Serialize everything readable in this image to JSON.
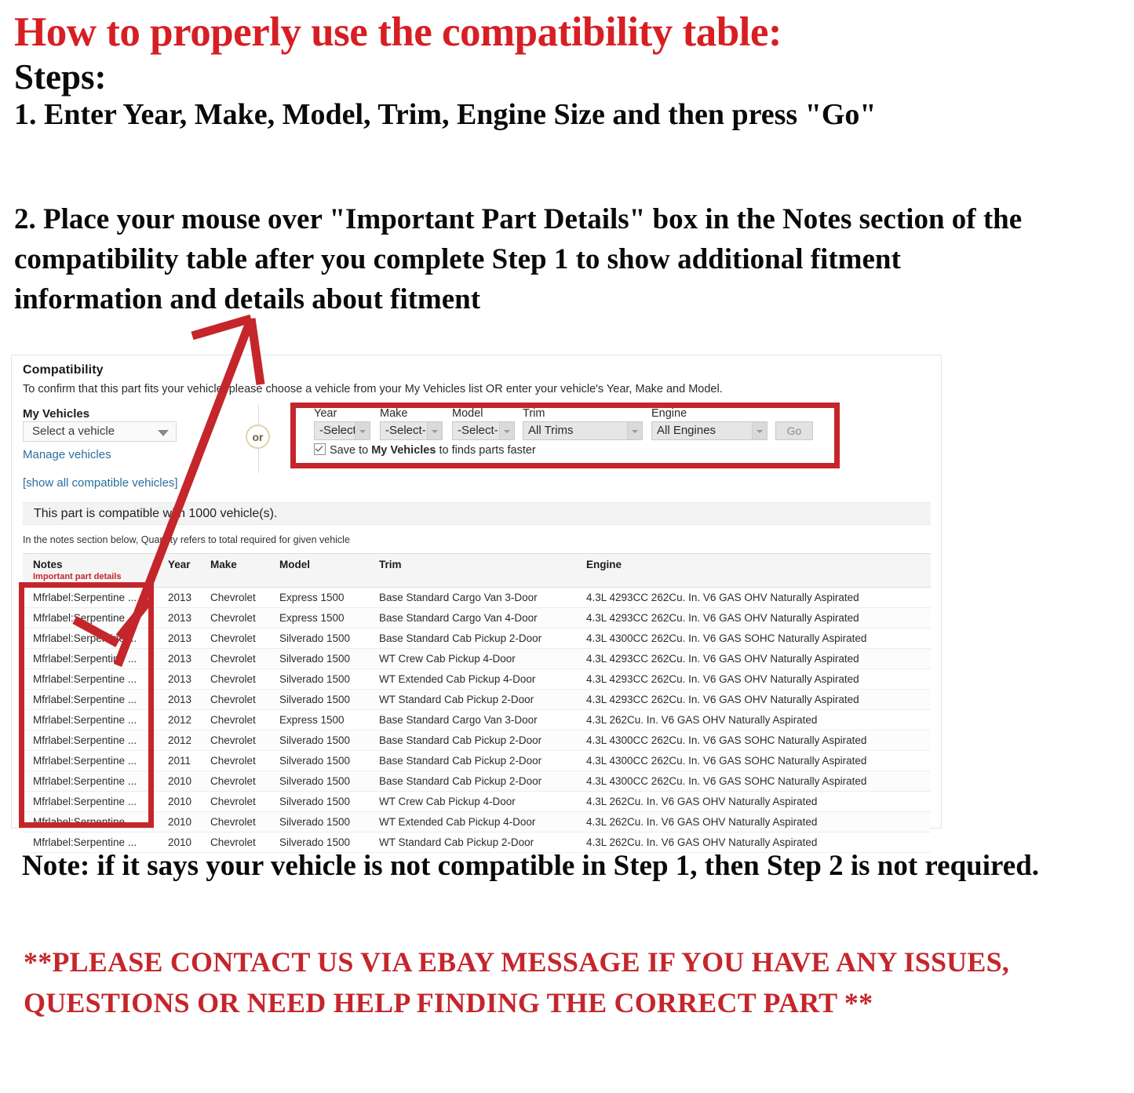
{
  "instructions": {
    "title": "How to properly use the compatibility table:",
    "steps_label": "Steps:",
    "step_one": "1. Enter Year, Make, Model, Trim, Engine Size and then press \"Go\"",
    "step_two": "2. Place your mouse over \"Important Part Details\" box in the Notes section of the compatibility table after you complete Step 1 to show additional fitment information and details about fitment",
    "note_bottom": "Note: if it says your vehicle is not compatible in Step 1, then Step 2 is not required.",
    "contact_notice": "**PLEASE CONTACT US VIA EBAY MESSAGE IF YOU HAVE ANY ISSUES, QUESTIONS OR NEED HELP FINDING THE CORRECT PART **"
  },
  "colors": {
    "accent_red": "#c4262b",
    "title_red": "#d71f23",
    "link_blue": "#2b6e9e",
    "or_ring": "#e0d5a8"
  },
  "compatibility": {
    "heading": "Compatibility",
    "subheading": "To confirm that this part fits your vehicle, please choose a vehicle from your My Vehicles list OR enter your vehicle's Year, Make and Model.",
    "my_vehicles": {
      "label": "My Vehicles",
      "select_value": "Select a vehicle",
      "manage_link": "Manage vehicles",
      "show_all_link": "[show all compatible vehicles]"
    },
    "or_divider": "or",
    "form": {
      "year": {
        "label": "Year",
        "value": "-Select-"
      },
      "make": {
        "label": "Make",
        "value": "-Select-"
      },
      "model": {
        "label": "Model",
        "value": "-Select-"
      },
      "trim": {
        "label": "Trim",
        "value": "All Trims"
      },
      "engine": {
        "label": "Engine",
        "value": "All Engines"
      },
      "go_button": "Go",
      "save_checkbox": {
        "prefix": "Save to ",
        "bold": "My Vehicles",
        "suffix": " to finds parts faster",
        "checked": true
      }
    },
    "result_message": "This part is compatible with 1000 vehicle(s).",
    "notes_hint": "In the notes section below, Quantity refers to total required for given vehicle"
  },
  "fitment_table": {
    "headers": {
      "notes": "Notes",
      "notes_sub": "Important part details",
      "year": "Year",
      "make": "Make",
      "model": "Model",
      "trim": "Trim",
      "engine": "Engine"
    },
    "rows": [
      {
        "notes": "Mfrlabel:Serpentine ...",
        "year": "2013",
        "make": "Chevrolet",
        "model": "Express 1500",
        "trim": "Base Standard Cargo Van 3-Door",
        "engine": "4.3L 4293CC 262Cu. In. V6 GAS OHV Naturally Aspirated"
      },
      {
        "notes": "Mfrlabel:Serpentine ...",
        "year": "2013",
        "make": "Chevrolet",
        "model": "Express 1500",
        "trim": "Base Standard Cargo Van 4-Door",
        "engine": "4.3L 4293CC 262Cu. In. V6 GAS OHV Naturally Aspirated"
      },
      {
        "notes": "Mfrlabel:Serpentine ...",
        "year": "2013",
        "make": "Chevrolet",
        "model": "Silverado 1500",
        "trim": "Base Standard Cab Pickup 2-Door",
        "engine": "4.3L 4300CC 262Cu. In. V6 GAS SOHC Naturally Aspirated"
      },
      {
        "notes": "Mfrlabel:Serpentine ...",
        "year": "2013",
        "make": "Chevrolet",
        "model": "Silverado 1500",
        "trim": "WT Crew Cab Pickup 4-Door",
        "engine": "4.3L 4293CC 262Cu. In. V6 GAS OHV Naturally Aspirated"
      },
      {
        "notes": "Mfrlabel:Serpentine ...",
        "year": "2013",
        "make": "Chevrolet",
        "model": "Silverado 1500",
        "trim": "WT Extended Cab Pickup 4-Door",
        "engine": "4.3L 4293CC 262Cu. In. V6 GAS OHV Naturally Aspirated"
      },
      {
        "notes": "Mfrlabel:Serpentine ...",
        "year": "2013",
        "make": "Chevrolet",
        "model": "Silverado 1500",
        "trim": "WT Standard Cab Pickup 2-Door",
        "engine": "4.3L 4293CC 262Cu. In. V6 GAS OHV Naturally Aspirated"
      },
      {
        "notes": "Mfrlabel:Serpentine ...",
        "year": "2012",
        "make": "Chevrolet",
        "model": "Express 1500",
        "trim": "Base Standard Cargo Van 3-Door",
        "engine": "4.3L 262Cu. In. V6 GAS OHV Naturally Aspirated"
      },
      {
        "notes": "Mfrlabel:Serpentine ...",
        "year": "2012",
        "make": "Chevrolet",
        "model": "Silverado 1500",
        "trim": "Base Standard Cab Pickup 2-Door",
        "engine": "4.3L 4300CC 262Cu. In. V6 GAS SOHC Naturally Aspirated"
      },
      {
        "notes": "Mfrlabel:Serpentine ...",
        "year": "2011",
        "make": "Chevrolet",
        "model": "Silverado 1500",
        "trim": "Base Standard Cab Pickup 2-Door",
        "engine": "4.3L 4300CC 262Cu. In. V6 GAS SOHC Naturally Aspirated"
      },
      {
        "notes": "Mfrlabel:Serpentine ...",
        "year": "2010",
        "make": "Chevrolet",
        "model": "Silverado 1500",
        "trim": "Base Standard Cab Pickup 2-Door",
        "engine": "4.3L 4300CC 262Cu. In. V6 GAS SOHC Naturally Aspirated"
      },
      {
        "notes": "Mfrlabel:Serpentine ...",
        "year": "2010",
        "make": "Chevrolet",
        "model": "Silverado 1500",
        "trim": "WT Crew Cab Pickup 4-Door",
        "engine": "4.3L 262Cu. In. V6 GAS OHV Naturally Aspirated"
      },
      {
        "notes": "Mfrlabel:Serpentine ...",
        "year": "2010",
        "make": "Chevrolet",
        "model": "Silverado 1500",
        "trim": "WT Extended Cab Pickup 4-Door",
        "engine": "4.3L 262Cu. In. V6 GAS OHV Naturally Aspirated"
      },
      {
        "notes": "Mfrlabel:Serpentine ...",
        "year": "2010",
        "make": "Chevrolet",
        "model": "Silverado 1500",
        "trim": "WT Standard Cab Pickup 2-Door",
        "engine": "4.3L 262Cu. In. V6 GAS OHV Naturally Aspirated"
      }
    ]
  }
}
